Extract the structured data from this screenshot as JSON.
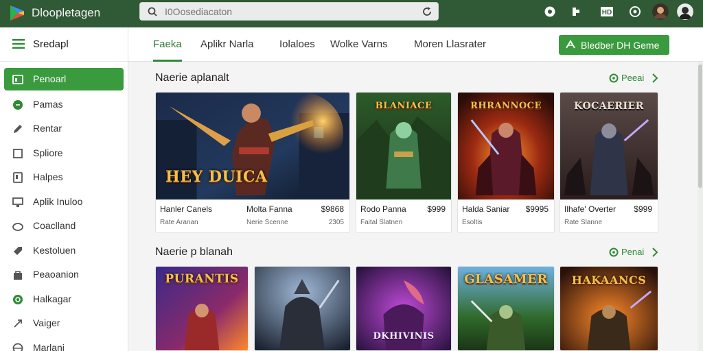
{
  "header": {
    "app_title": "Dloopletagen",
    "search": {
      "value": "",
      "placeholder": "I0Oosediacaton"
    },
    "icons": [
      "refresh-icon",
      "gamepad-icon",
      "puzzle-icon",
      "badge-icon",
      "settings-icon",
      "user-avatar",
      "profile-avatar"
    ]
  },
  "sidebar": {
    "header_label": "Sredapl",
    "items": [
      {
        "label": "Penoarl",
        "icon": "store-icon",
        "active": true
      },
      {
        "label": "Pamas",
        "icon": "chat-icon"
      },
      {
        "label": "Rentar",
        "icon": "pen-icon"
      },
      {
        "label": "Spliore",
        "icon": "square-icon"
      },
      {
        "label": "Halpes",
        "icon": "tablet-icon"
      },
      {
        "label": "Aplik Inuloo",
        "icon": "monitor-icon"
      },
      {
        "label": "Coaclland",
        "icon": "cloud-icon"
      },
      {
        "label": "Kestoluen",
        "icon": "tag-icon"
      },
      {
        "label": "Peaoanion",
        "icon": "bag-icon"
      },
      {
        "label": "Halkagar",
        "icon": "refresh-circle-icon"
      },
      {
        "label": "Vaiger",
        "icon": "gear-icon"
      },
      {
        "label": "Marlani",
        "icon": "globe-icon"
      }
    ]
  },
  "tabs": [
    {
      "label": "Faeka",
      "active": true
    },
    {
      "label": "Aplikr Narla"
    },
    {
      "label": "Iolaloes"
    },
    {
      "label": "Wolke   Varns"
    },
    {
      "label": "Moren Llasrater"
    }
  ],
  "cta_label": "Bledber DH Geme",
  "sections": [
    {
      "title": "Naerie aplanalt",
      "see_all": "Peeai",
      "cards": [
        {
          "art_title": "HEY DUICA",
          "name": "Hanler Canels",
          "subtitle": "Rate Aranan",
          "name2": "Molta Fanna",
          "subtitle2": "Nerie Scenne",
          "price": "$9868",
          "price2": "2305"
        },
        {
          "art_title": "BLANIACE",
          "name": "Rodo Panna",
          "subtitle": "Faital Slatnen",
          "price": "$999"
        },
        {
          "art_title": "RHRANNOCE",
          "name": "Halda Saniar",
          "subtitle": "Esoltis",
          "price": "$9995"
        },
        {
          "art_title": "KOCAERIER",
          "name": "Ilhafe' Overter",
          "subtitle": "Rate Slanne",
          "price": "$999"
        }
      ]
    },
    {
      "title": "Naerie p blanah",
      "see_all": "Penai",
      "cards": [
        {
          "art_title": "PURANTIS"
        },
        {
          "art_title": ""
        },
        {
          "art_title": "DKHIVINIS"
        },
        {
          "art_title": "GLASAMER"
        },
        {
          "art_title": "HAKAANCS"
        }
      ]
    }
  ],
  "colors": {
    "topbar": "#2f5a35",
    "accent": "#3a9a3e",
    "accent_text": "#2f8a35",
    "sidebar_bg": "#ffffff",
    "page_bg": "#f3f4f3"
  }
}
